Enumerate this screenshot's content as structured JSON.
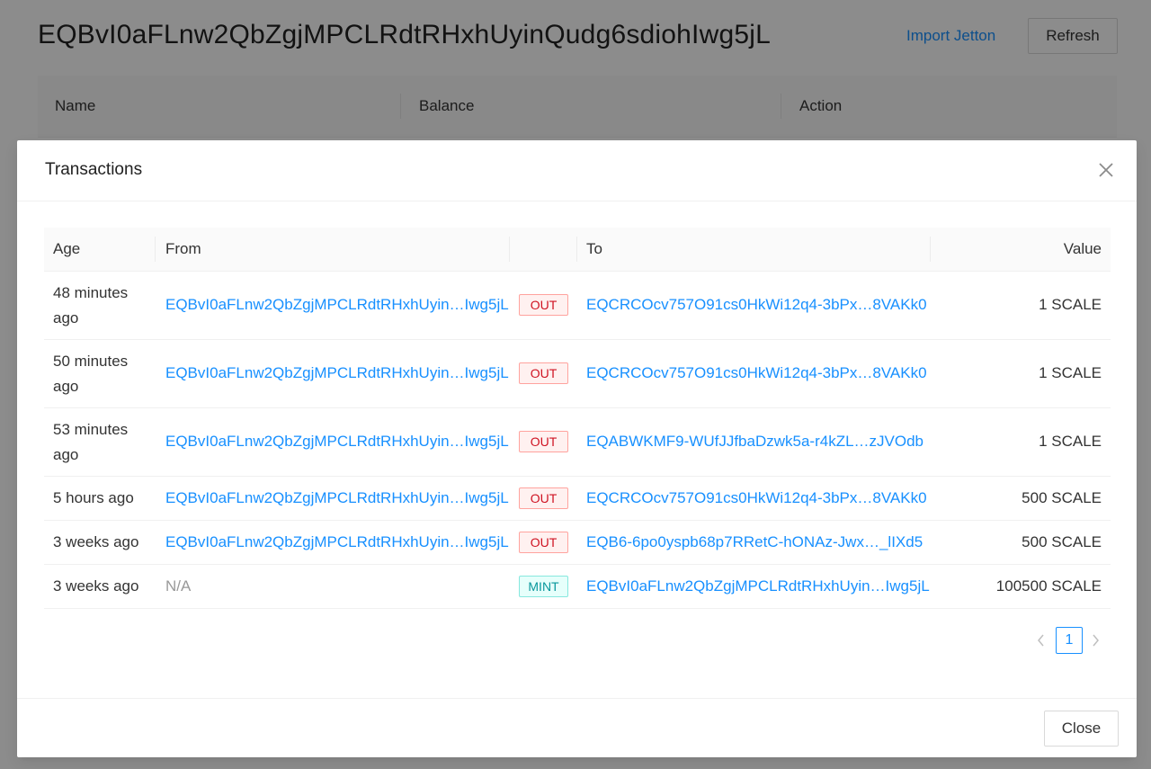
{
  "page": {
    "title": "EQBvI0aFLnw2QbZgjMPCLRdtRHxhUyinQudg6sdiohIwg5jL",
    "import_link": "Import Jetton",
    "refresh_label": "Refresh",
    "table_headers": [
      "Name",
      "Balance",
      "Action"
    ]
  },
  "modal": {
    "title": "Transactions",
    "close_label": "Close",
    "headers": {
      "age": "Age",
      "from": "From",
      "to": "To",
      "value": "Value"
    },
    "rows": [
      {
        "age": "48 minutes ago",
        "from": "EQBvI0aFLnw2QbZgjMPCLRdtRHxhUyin…Iwg5jL",
        "dir": "OUT",
        "to": "EQCRCOcv757O91cs0HkWi12q4-3bPx…8VAKk0",
        "value": "1 SCALE"
      },
      {
        "age": "50 minutes ago",
        "from": "EQBvI0aFLnw2QbZgjMPCLRdtRHxhUyin…Iwg5jL",
        "dir": "OUT",
        "to": "EQCRCOcv757O91cs0HkWi12q4-3bPx…8VAKk0",
        "value": "1 SCALE"
      },
      {
        "age": "53 minutes ago",
        "from": "EQBvI0aFLnw2QbZgjMPCLRdtRHxhUyin…Iwg5jL",
        "dir": "OUT",
        "to": "EQABWKMF9-WUfJJfbaDzwk5a-r4kZL…zJVOdb",
        "value": "1 SCALE"
      },
      {
        "age": "5 hours ago",
        "from": "EQBvI0aFLnw2QbZgjMPCLRdtRHxhUyin…Iwg5jL",
        "dir": "OUT",
        "to": "EQCRCOcv757O91cs0HkWi12q4-3bPx…8VAKk0",
        "value": "500 SCALE"
      },
      {
        "age": "3 weeks ago",
        "from": "EQBvI0aFLnw2QbZgjMPCLRdtRHxhUyin…Iwg5jL",
        "dir": "OUT",
        "to": "EQB6-6po0yspb68p7RRetC-hONAz-Jwx…_lIXd5",
        "value": "500 SCALE"
      },
      {
        "age": "3 weeks ago",
        "from": "N/A",
        "dir": "MINT",
        "to": "EQBvI0aFLnw2QbZgjMPCLRdtRHxhUyin…Iwg5jL",
        "value": "100500 SCALE"
      }
    ],
    "pagination": {
      "current": "1"
    }
  },
  "icons": {
    "close": "close-icon",
    "prev": "chevron-left-icon",
    "next": "chevron-right-icon"
  },
  "colors": {
    "link": "#1890ff",
    "out": "#cf1322",
    "mint": "#08979c"
  }
}
